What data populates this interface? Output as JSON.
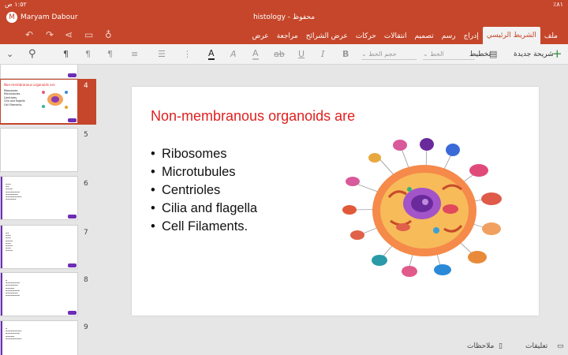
{
  "status_bar": {
    "time": "١:٥٢ ص",
    "battery": "٪٨١"
  },
  "title_bar": {
    "user_initial": "M",
    "user_name": "Maryam Dabour",
    "document": "histology - محفوظ"
  },
  "ribbon_tabs": [
    {
      "label": "ملف"
    },
    {
      "label": "الشريط الرئيسي"
    },
    {
      "label": "إدراج"
    },
    {
      "label": "رسم"
    },
    {
      "label": "تصميم"
    },
    {
      "label": "انتقالات"
    },
    {
      "label": "حركات"
    },
    {
      "label": "عرض الشرائح"
    },
    {
      "label": "مراجعة"
    },
    {
      "label": "عرض"
    }
  ],
  "toolbar": {
    "new_slide": "شريحة جديدة",
    "layout": "تخطيط",
    "font_name": "الخط",
    "font_size": "حجم الخط",
    "bold": "B",
    "italic": "I",
    "underline": "U",
    "strikethrough": "ab",
    "font_color_glyph": "A",
    "highlight_glyph": "A",
    "clear_format": "A",
    "paragraph_ltr": "¶",
    "paragraph_rtl": "¶",
    "show_para": "¶"
  },
  "slides": [
    {
      "number": "4",
      "title": "Non-membranous organoids are",
      "bullets": [
        "Ribosomes",
        "Microtubules",
        "Centrioles",
        "Cilia and flagella",
        "Cell Filaments."
      ]
    },
    {
      "number": "5"
    },
    {
      "number": "6"
    },
    {
      "number": "7"
    },
    {
      "number": "8"
    },
    {
      "number": "9"
    }
  ],
  "main_slide": {
    "title": "Non-membranous organoids are",
    "bullets": [
      "Ribosomes",
      "Microtubules",
      "Centrioles",
      "Cilia and flagella",
      "Cell Filaments."
    ],
    "bullet_glyph": "•"
  },
  "bottom_bar": {
    "notes": "ملاحظات",
    "comments": "تعليقات"
  },
  "colors": {
    "accent": "#c5462a",
    "title_red": "#e02020",
    "thumbnail_tag": "#6d2db4"
  }
}
